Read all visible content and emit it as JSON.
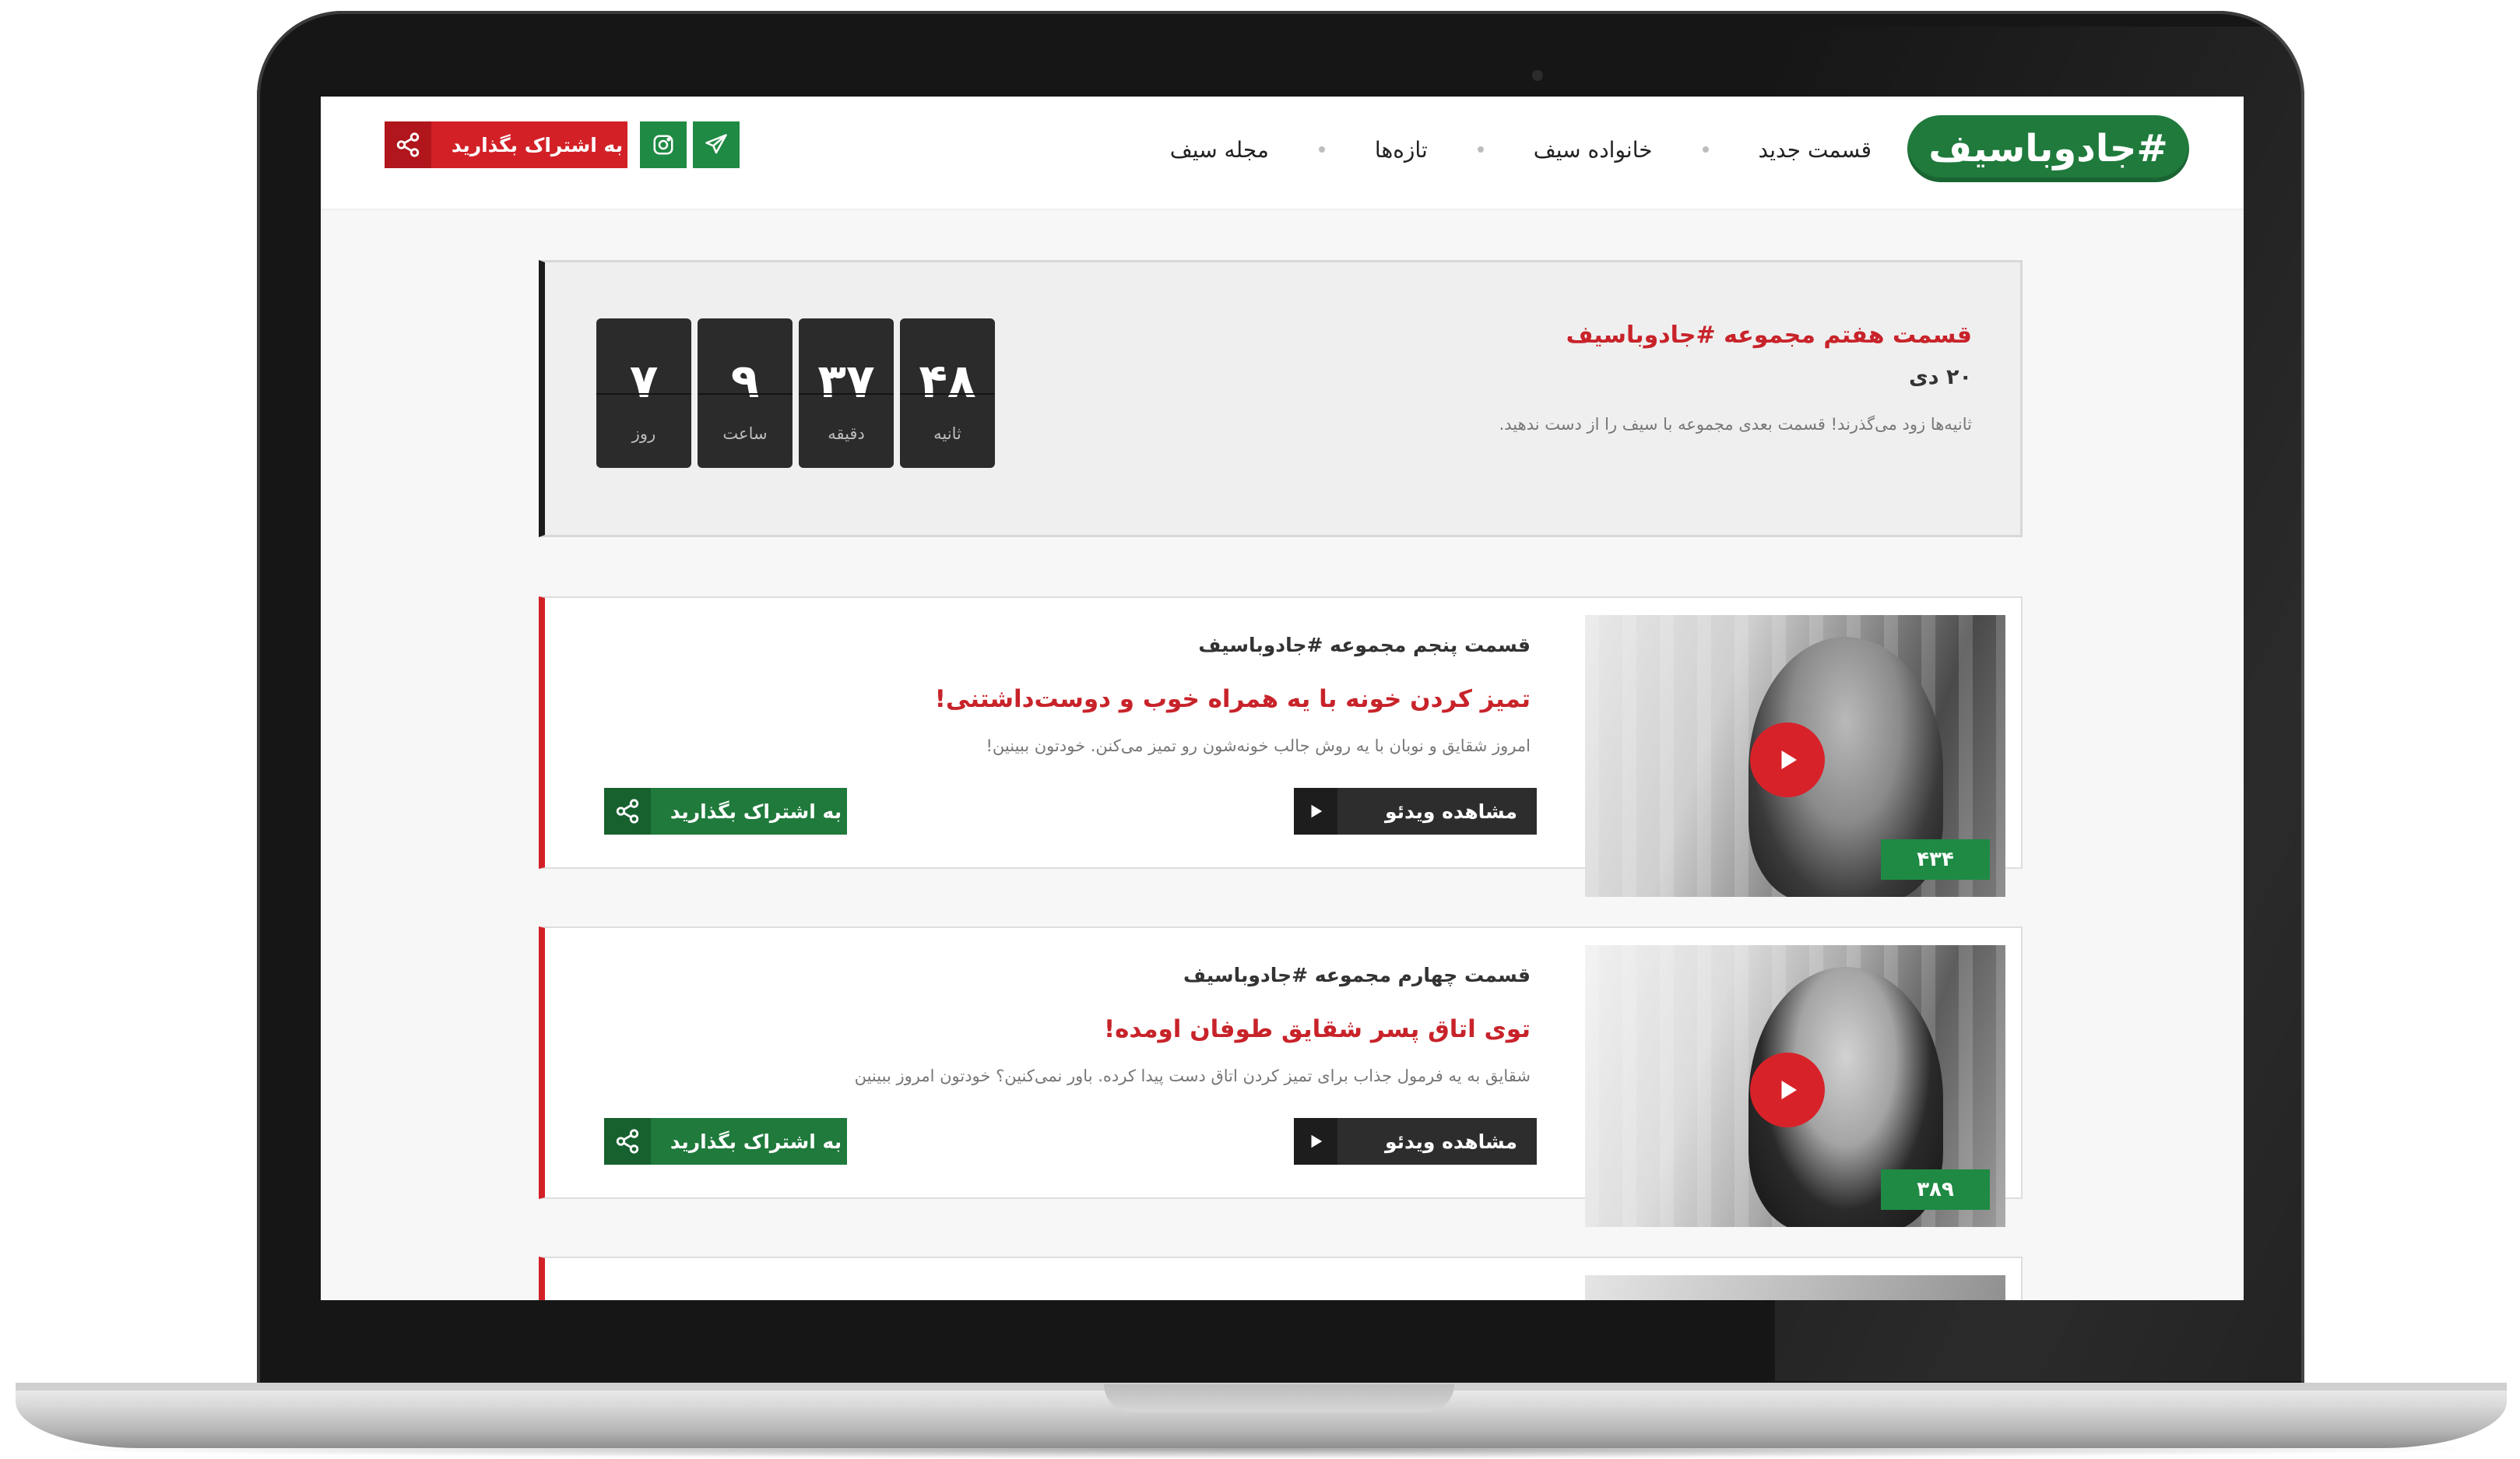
{
  "brand": {
    "logo": "#جادوباسیف",
    "green": "#1f7a3c",
    "red": "#d32027",
    "dark": "#2b2b2b"
  },
  "nav": {
    "items": [
      "قسمت جدید",
      "خانواده سیف",
      "تازه‌ها",
      "مجله سیف"
    ]
  },
  "header": {
    "share_label": "به اشتراک بگذارید",
    "share_icon": "share-icon",
    "instagram_icon": "instagram-icon",
    "telegram_icon": "telegram-icon"
  },
  "countdown": {
    "title": "قسمت هفتم مجموعه #جادوباسیف",
    "date": "۲۰ دی",
    "text": "ثانیه‌ها زود می‌گذرند! قسمت بعدی مجموعه با سیف را از دست ندهید.",
    "units": [
      {
        "value": "۴۸",
        "label": "ثانیه"
      },
      {
        "value": "۳۷",
        "label": "دقیقه"
      },
      {
        "value": "۹",
        "label": "ساعت"
      },
      {
        "value": "۷",
        "label": "روز"
      }
    ]
  },
  "episodes": [
    {
      "label": "قسمت پنجم مجموعه #جادوباسیف",
      "title": "تمیز کردن خونه با یه همراه خوب و دوست‌داشتنی!",
      "description": "امروز شقایق و نوبان با یه روش جالب خونه‌شون رو تمیز می‌کنن. خودتون ببینین!",
      "views": "۴۳۴",
      "watch_label": "مشاهده ویدئو",
      "share_label": "به اشتراک بگذارید"
    },
    {
      "label": "قسمت چهارم مجموعه #جادوباسیف",
      "title": "توی اتاق پسر شقایق طوفان اومده!",
      "description": "شقایق به یه فرمول جذاب برای تمیز کردن اتاق دست پیدا کرده. باور نمی‌کنین؟ خودتون امروز ببینین",
      "views": "۳۸۹",
      "watch_label": "مشاهده ویدئو",
      "share_label": "به اشتراک بگذارید"
    }
  ]
}
